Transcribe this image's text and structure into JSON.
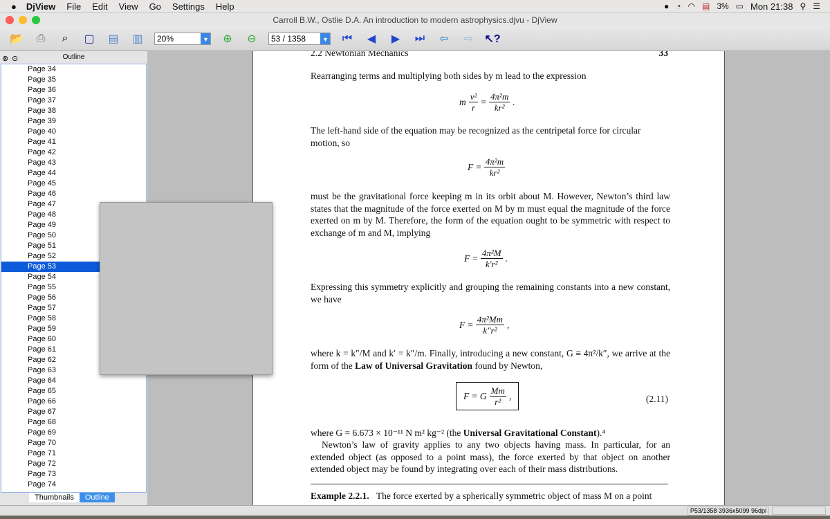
{
  "menubar": {
    "app": "DjView",
    "items": [
      "File",
      "Edit",
      "View",
      "Go",
      "Settings",
      "Help"
    ],
    "battery": "3%",
    "clock": "Mon 21:38"
  },
  "window": {
    "title": "Carroll B.W., Ostlie D.A. An introduction to modern astrophysics.djvu - DjView"
  },
  "toolbar": {
    "zoom": "20%",
    "page": "53 / 1358"
  },
  "sidebar": {
    "title": "Outline",
    "pages": [
      "Page 34",
      "Page 35",
      "Page 36",
      "Page 37",
      "Page 38",
      "Page 39",
      "Page 40",
      "Page 41",
      "Page 42",
      "Page 43",
      "Page 44",
      "Page 45",
      "Page 46",
      "Page 47",
      "Page 48",
      "Page 49",
      "Page 50",
      "Page 51",
      "Page 52",
      "Page 53",
      "Page 54",
      "Page 55",
      "Page 56",
      "Page 57",
      "Page 58",
      "Page 59",
      "Page 60",
      "Page 61",
      "Page 62",
      "Page 63",
      "Page 64",
      "Page 65",
      "Page 66",
      "Page 67",
      "Page 68",
      "Page 69",
      "Page 70",
      "Page 71",
      "Page 72",
      "Page 73",
      "Page 74"
    ],
    "selected": "Page 53",
    "tabs": [
      "Thumbnails",
      "Outline"
    ],
    "active_tab": "Outline"
  },
  "document": {
    "header": "2.2   Newtonian Mechanics",
    "page_number": "33",
    "p1": "Rearranging terms and multiplying both sides by m lead to the expression",
    "p2": "The left-hand side of the equation may be recognized as the centripetal force for circular motion, so",
    "p3": "must be the gravitational force keeping m in its orbit about M. However, Newton’s third law states that the magnitude of the force exerted on M by m must equal the magnitude of the force exerted on m by M. Therefore, the form of the equation ought to be symmetric with respect to exchange of m and M, implying",
    "p4": "Expressing this symmetry explicitly and grouping the remaining constants into a new constant, we have",
    "p5a": "where k = k″/M and k′ = k″/m. Finally, introducing a new constant, G ≡ 4π²/k″, we arrive at the form of the ",
    "p5b": "Law of Universal Gravitation",
    "p5c": " found by Newton,",
    "eq_number": "(2.11)",
    "p6a": "where G = 6.673 × 10⁻¹¹ N m² kg⁻² (the ",
    "p6b": "Universal Gravitational Constant",
    "p6c": ").⁴",
    "p7": "Newton’s law of gravity applies to any two objects having mass. In particular, for an extended object (as opposed to a point mass), the force exerted by that object on another extended object may be found by integrating over each of their mass distributions.",
    "example_label": "Example 2.2.1.",
    "example_text": "The force exerted by a spherically symmetric object of mass M on a point"
  },
  "status": {
    "text": "P53/1358 3936x5099 96dpi"
  }
}
